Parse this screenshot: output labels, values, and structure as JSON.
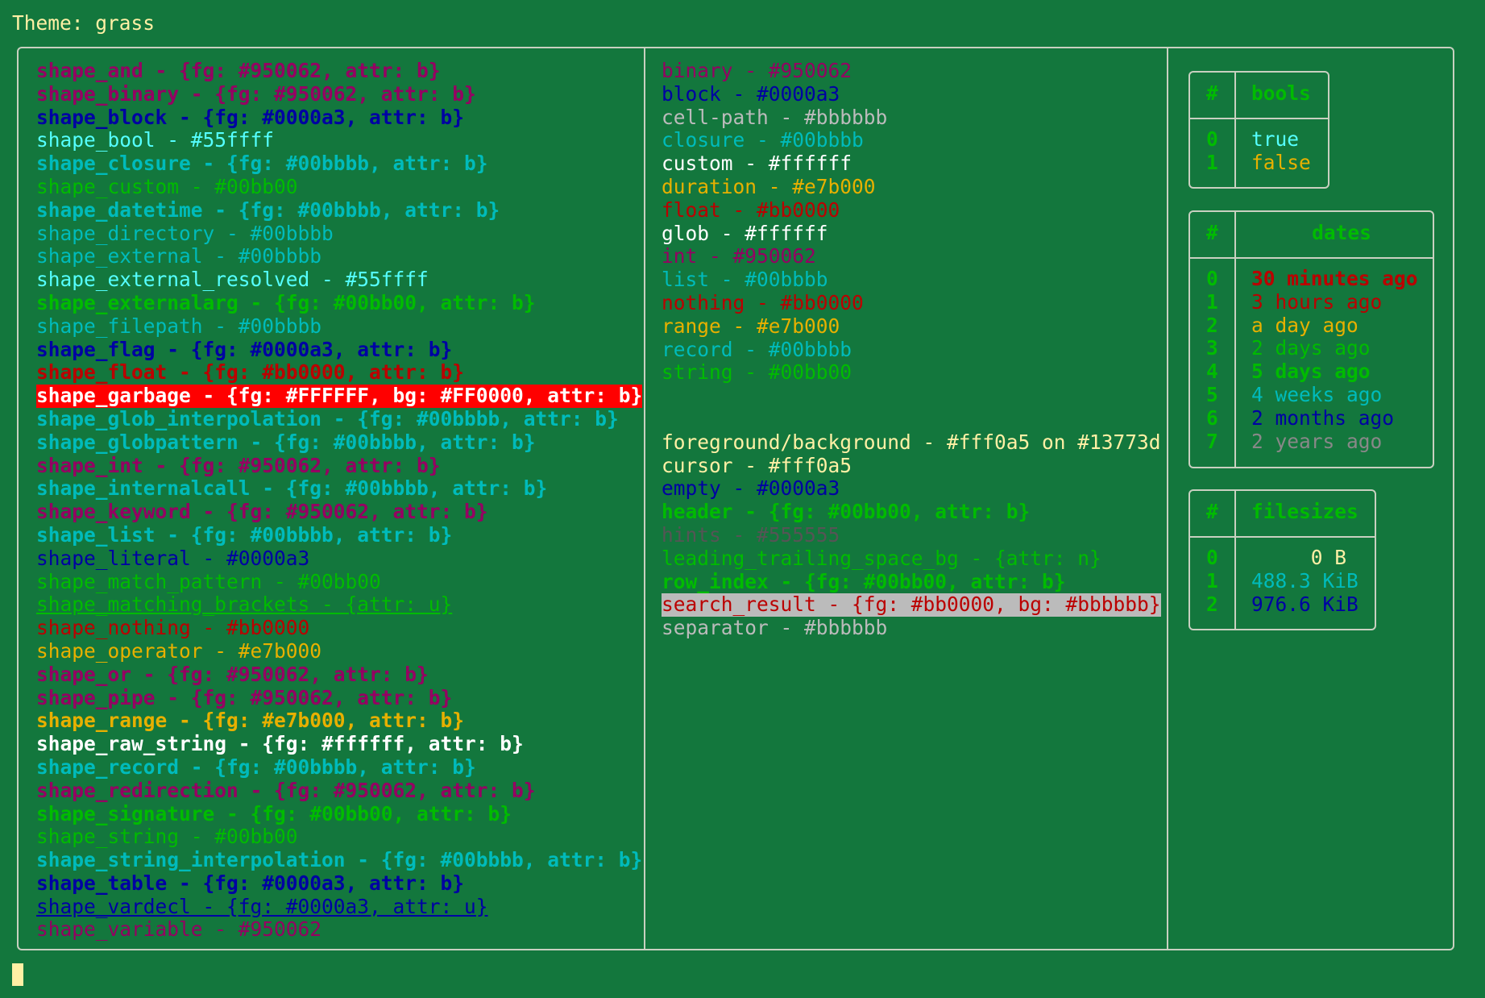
{
  "theme_label": "Theme: grass",
  "col1": [
    {
      "text": "shape_and - {fg: #950062, attr: b}",
      "fg": "#950062",
      "b": true
    },
    {
      "text": "shape_binary - {fg: #950062, attr: b}",
      "fg": "#950062",
      "b": true
    },
    {
      "text": "shape_block - {fg: #0000a3, attr: b}",
      "fg": "#0000a3",
      "b": true
    },
    {
      "text": "shape_bool - #55ffff",
      "fg": "#55ffff"
    },
    {
      "text": "shape_closure - {fg: #00bbbb, attr: b}",
      "fg": "#00bbbb",
      "b": true
    },
    {
      "text": "shape_custom - #00bb00",
      "fg": "#00bb00"
    },
    {
      "text": "shape_datetime - {fg: #00bbbb, attr: b}",
      "fg": "#00bbbb",
      "b": true
    },
    {
      "text": "shape_directory - #00bbbb",
      "fg": "#00bbbb"
    },
    {
      "text": "shape_external - #00bbbb",
      "fg": "#00bbbb"
    },
    {
      "text": "shape_external_resolved - #55ffff",
      "fg": "#55ffff"
    },
    {
      "text": "shape_externalarg - {fg: #00bb00, attr: b}",
      "fg": "#00bb00",
      "b": true
    },
    {
      "text": "shape_filepath - #00bbbb",
      "fg": "#00bbbb"
    },
    {
      "text": "shape_flag - {fg: #0000a3, attr: b}",
      "fg": "#0000a3",
      "b": true
    },
    {
      "text": "shape_float - {fg: #bb0000, attr: b}",
      "fg": "#bb0000",
      "b": true
    },
    {
      "text": "shape_garbage - {fg: #FFFFFF, bg: #FF0000, attr: b}",
      "fg": "#FFFFFF",
      "bg": "#FF0000",
      "b": true
    },
    {
      "text": "shape_glob_interpolation - {fg: #00bbbb, attr: b}",
      "fg": "#00bbbb",
      "b": true
    },
    {
      "text": "shape_globpattern - {fg: #00bbbb, attr: b}",
      "fg": "#00bbbb",
      "b": true
    },
    {
      "text": "shape_int - {fg: #950062, attr: b}",
      "fg": "#950062",
      "b": true
    },
    {
      "text": "shape_internalcall - {fg: #00bbbb, attr: b}",
      "fg": "#00bbbb",
      "b": true
    },
    {
      "text": "shape_keyword - {fg: #950062, attr: b}",
      "fg": "#950062",
      "b": true
    },
    {
      "text": "shape_list - {fg: #00bbbb, attr: b}",
      "fg": "#00bbbb",
      "b": true
    },
    {
      "text": "shape_literal - #0000a3",
      "fg": "#0000a3"
    },
    {
      "text": "shape_match_pattern - #00bb00",
      "fg": "#00bb00"
    },
    {
      "text": "shape_matching_brackets - {attr: u}",
      "fg": "#00bb00",
      "u": true
    },
    {
      "text": "shape_nothing - #bb0000",
      "fg": "#bb0000"
    },
    {
      "text": "shape_operator - #e7b000",
      "fg": "#e7b000"
    },
    {
      "text": "shape_or - {fg: #950062, attr: b}",
      "fg": "#950062",
      "b": true
    },
    {
      "text": "shape_pipe - {fg: #950062, attr: b}",
      "fg": "#950062",
      "b": true
    },
    {
      "text": "shape_range - {fg: #e7b000, attr: b}",
      "fg": "#e7b000",
      "b": true
    },
    {
      "text": "shape_raw_string - {fg: #ffffff, attr: b}",
      "fg": "#ffffff",
      "b": true
    },
    {
      "text": "shape_record - {fg: #00bbbb, attr: b}",
      "fg": "#00bbbb",
      "b": true
    },
    {
      "text": "shape_redirection - {fg: #950062, attr: b}",
      "fg": "#950062",
      "b": true
    },
    {
      "text": "shape_signature - {fg: #00bb00, attr: b}",
      "fg": "#00bb00",
      "b": true
    },
    {
      "text": "shape_string - #00bb00",
      "fg": "#00bb00"
    },
    {
      "text": "shape_string_interpolation - {fg: #00bbbb, attr: b}",
      "fg": "#00bbbb",
      "b": true
    },
    {
      "text": "shape_table - {fg: #0000a3, attr: b}",
      "fg": "#0000a3",
      "b": true
    },
    {
      "text": "shape_vardecl - {fg: #0000a3, attr: u}",
      "fg": "#0000a3",
      "u": true
    },
    {
      "text": "shape_variable - #950062",
      "fg": "#950062"
    }
  ],
  "col2_types": [
    {
      "text": "binary - #950062",
      "fg": "#950062"
    },
    {
      "text": "block - #0000a3",
      "fg": "#0000a3"
    },
    {
      "text": "cell-path - #bbbbbb",
      "fg": "#bbbbbb"
    },
    {
      "text": "closure - #00bbbb",
      "fg": "#00bbbb"
    },
    {
      "text": "custom - #ffffff",
      "fg": "#ffffff"
    },
    {
      "text": "duration - #e7b000",
      "fg": "#e7b000"
    },
    {
      "text": "float - #bb0000",
      "fg": "#bb0000"
    },
    {
      "text": "glob - #ffffff",
      "fg": "#ffffff"
    },
    {
      "text": "int - #950062",
      "fg": "#950062"
    },
    {
      "text": "list - #00bbbb",
      "fg": "#00bbbb"
    },
    {
      "text": "nothing - #bb0000",
      "fg": "#bb0000"
    },
    {
      "text": "range - #e7b000",
      "fg": "#e7b000"
    },
    {
      "text": "record - #00bbbb",
      "fg": "#00bbbb"
    },
    {
      "text": "string - #00bb00",
      "fg": "#00bb00"
    }
  ],
  "col2_ui": [
    {
      "text": "foreground/background - #fff0a5 on #13773d",
      "fg": "#fff0a5"
    },
    {
      "text": "cursor - #fff0a5",
      "fg": "#fff0a5"
    },
    {
      "text": "empty - #0000a3",
      "fg": "#0000a3"
    },
    {
      "text": "header - {fg: #00bb00, attr: b}",
      "fg": "#00bb00",
      "b": true
    },
    {
      "text": "hints - #555555",
      "fg": "#555555"
    },
    {
      "text": "leading_trailing_space_bg - {attr: n}",
      "fg": "#00bb00"
    },
    {
      "text": "row_index - {fg: #00bb00, attr: b}",
      "fg": "#00bb00",
      "b": true
    },
    {
      "text": "search_result - {fg: #bb0000, bg: #bbbbbb}",
      "fg": "#bb0000",
      "bg": "#bbbbbb"
    },
    {
      "text": "separator - #bbbbbb",
      "fg": "#bbbbbb"
    }
  ],
  "tables": {
    "bools": {
      "index_header": "#",
      "header": "bools",
      "rows": [
        {
          "idx": "0",
          "val": "true",
          "fg": "#55ffff"
        },
        {
          "idx": "1",
          "val": "false",
          "fg": "#e7b000"
        }
      ]
    },
    "dates": {
      "index_header": "#",
      "header": "dates",
      "rows": [
        {
          "idx": "0",
          "val": "30 minutes ago",
          "fg": "#bb0000",
          "b": true
        },
        {
          "idx": "1",
          "val": "3 hours ago",
          "fg": "#bb0000"
        },
        {
          "idx": "2",
          "val": "a day ago",
          "fg": "#e7b000"
        },
        {
          "idx": "3",
          "val": "2 days ago",
          "fg": "#00bb00"
        },
        {
          "idx": "4",
          "val": "5 days ago",
          "fg": "#00bb00",
          "b": true
        },
        {
          "idx": "5",
          "val": "4 weeks ago",
          "fg": "#00bbbb"
        },
        {
          "idx": "6",
          "val": "2 months ago",
          "fg": "#0000a3"
        },
        {
          "idx": "7",
          "val": "2 years ago",
          "fg": "#888888"
        }
      ]
    },
    "filesizes": {
      "index_header": "#",
      "header": "filesizes",
      "rows": [
        {
          "idx": "0",
          "val": "     0 B",
          "fg": "#fff0a5"
        },
        {
          "idx": "1",
          "val": "488.3 KiB",
          "fg": "#00bbbb"
        },
        {
          "idx": "2",
          "val": "976.6 KiB",
          "fg": "#0000a3"
        }
      ]
    }
  },
  "colors": {
    "background": "#13773d",
    "foreground": "#fff0a5",
    "border": "#c8d0c0",
    "header": "#00bb00",
    "row_index": "#00bb00"
  }
}
